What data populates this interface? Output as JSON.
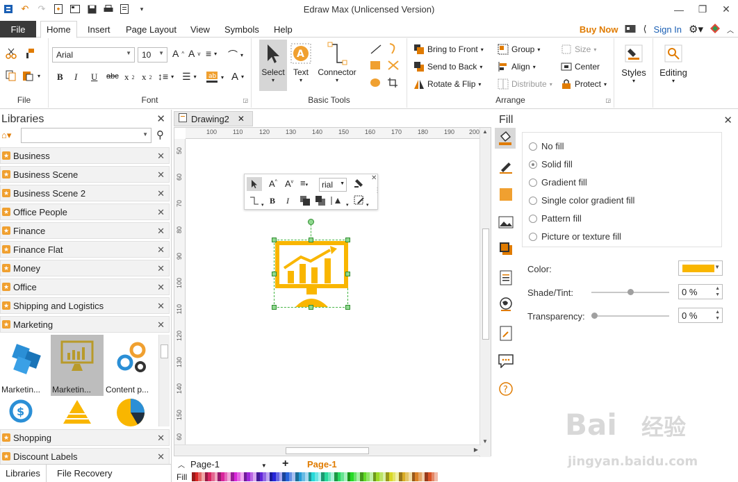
{
  "window": {
    "title": "Edraw Max (Unlicensed Version)"
  },
  "menu": {
    "file": "File",
    "tabs": [
      "Home",
      "Insert",
      "Page Layout",
      "View",
      "Symbols",
      "Help"
    ],
    "buy_now": "Buy Now",
    "sign_in": "Sign In"
  },
  "ribbon": {
    "file_group": "File",
    "font_group": "Font",
    "font_name": "Arial",
    "font_size": "10",
    "basic_tools_group": "Basic Tools",
    "select": "Select",
    "text": "Text",
    "connector": "Connector",
    "arrange_group": "Arrange",
    "bring_to_front": "Bring to Front",
    "send_to_back": "Send to Back",
    "rotate_flip": "Rotate & Flip",
    "group": "Group",
    "align": "Align",
    "distribute": "Distribute",
    "size": "Size",
    "center": "Center",
    "protect": "Protect",
    "styles": "Styles",
    "editing": "Editing"
  },
  "libraries": {
    "title": "Libraries",
    "categories": [
      "Business",
      "Business Scene",
      "Business Scene 2",
      "Office People",
      "Finance",
      "Finance Flat",
      "Money",
      "Office",
      "Shipping and Logistics",
      "Marketing"
    ],
    "shapes": [
      "Marketin...",
      "Marketin...",
      "Content p..."
    ],
    "bottom_categories": [
      "Shopping",
      "Discount Labels"
    ],
    "tabs": [
      "Libraries",
      "File Recovery"
    ]
  },
  "document": {
    "tab": "Drawing2",
    "ruler_h": [
      "100",
      "110",
      "120",
      "130",
      "140",
      "150",
      "160",
      "170",
      "180",
      "190",
      "200"
    ],
    "ruler_v": [
      "50",
      "60",
      "70",
      "80",
      "90",
      "100",
      "110",
      "120",
      "130",
      "140",
      "150",
      "60"
    ],
    "mini_font": "rial",
    "page_select": "Page-1",
    "page_tab": "Page-1",
    "fill_label": "Fill"
  },
  "fill": {
    "title": "Fill",
    "options": [
      "No fill",
      "Solid fill",
      "Gradient fill",
      "Single color gradient fill",
      "Pattern fill",
      "Picture or texture fill"
    ],
    "selected_index": 1,
    "color_label": "Color:",
    "color_value": "#f9b600",
    "shade_label": "Shade/Tint:",
    "shade_value": "0 %",
    "shade_level": 0.5,
    "transparency_label": "Transparency:",
    "transparency_value": "0 %",
    "transparency_level": 0
  },
  "colors": {
    "accent": "#e07b00",
    "shape_yellow": "#f9b600",
    "selection": "#44b544",
    "file_tab": "#3a3a3a"
  }
}
